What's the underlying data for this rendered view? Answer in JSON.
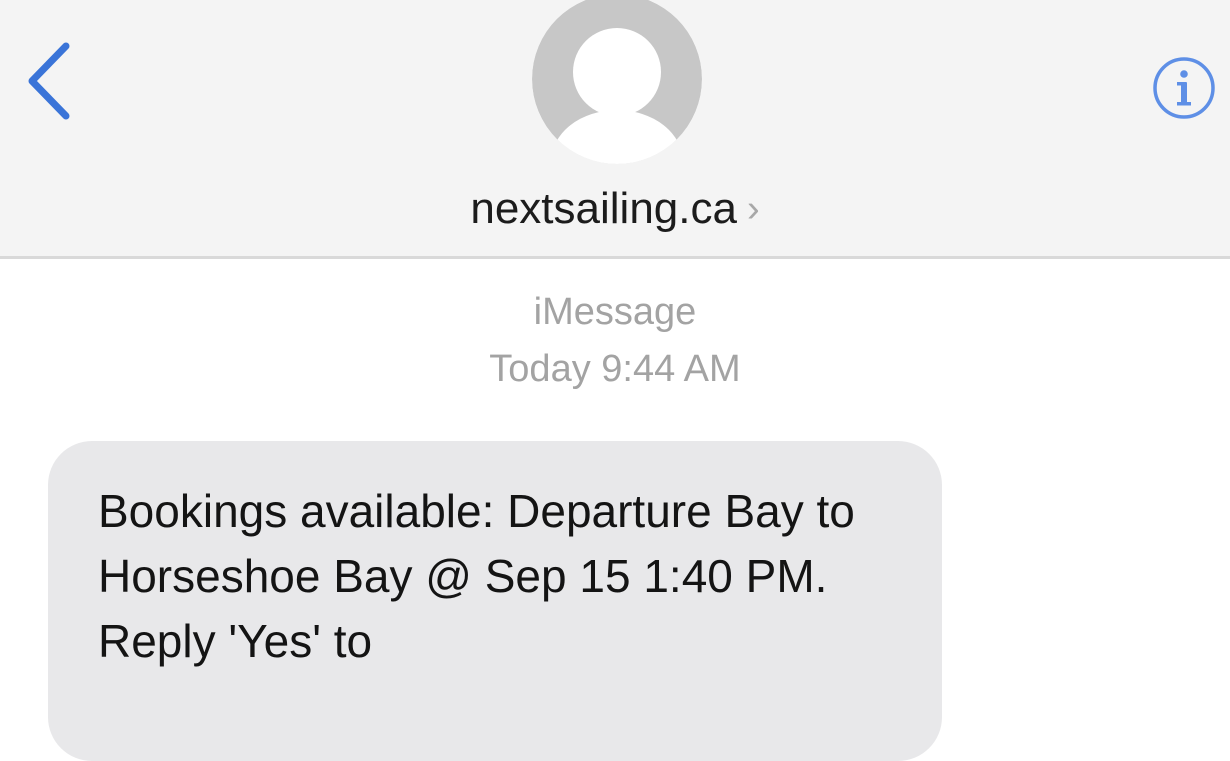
{
  "nav": {
    "back_icon": "chevron-left-icon",
    "info_icon": "info-icon",
    "accent_color": "#3478f6"
  },
  "contact": {
    "name": "nextsailing.ca",
    "chevron": "›",
    "avatar_icon": "person-placeholder-icon"
  },
  "conversation": {
    "service_label": "iMessage",
    "timestamp": "Today 9:44 AM",
    "messages": [
      {
        "direction": "incoming",
        "text": "Bookings available: Departure Bay to Horseshoe Bay @ Sep 15 1:40 PM. Reply 'Yes' to"
      }
    ]
  }
}
